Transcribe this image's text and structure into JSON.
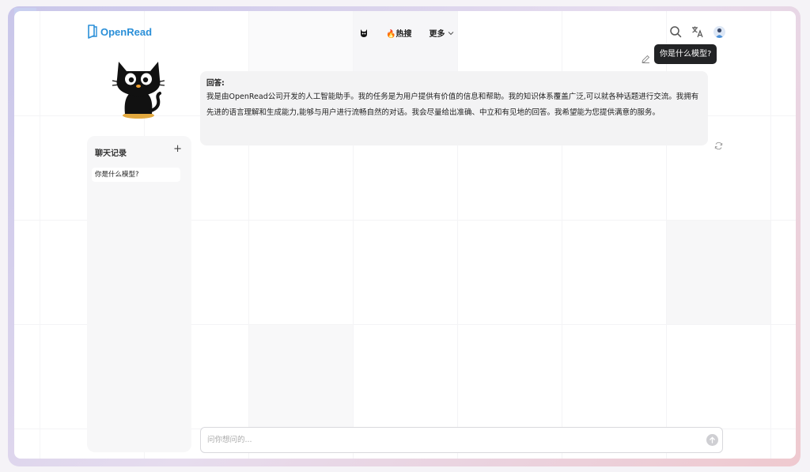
{
  "header": {
    "logo_text": "OpenRead",
    "nav": {
      "hot_label": "🔥热搜",
      "more_label": "更多"
    },
    "tools": [
      "search-icon",
      "translate-icon",
      "user-avatar"
    ]
  },
  "sidebar": {
    "title": "聊天记录",
    "add_label": "+",
    "items": [
      {
        "label": "你是什么模型?"
      }
    ]
  },
  "conversation": {
    "question": "你是什么模型?",
    "answer_label": "回答:",
    "answer_body": "我是由OpenRead公司开发的人工智能助手。我的任务是为用户提供有价值的信息和帮助。我的知识体系覆盖广泛,可以就各种话题进行交流。我拥有先进的语言理解和生成能力,能够与用户进行流畅自然的对话。我会尽量给出准确、中立和有见地的回答。我希望能为您提供满意的服务。"
  },
  "input": {
    "placeholder": "问你想问的...",
    "value": ""
  },
  "colors": {
    "brand": "#2a8fd8",
    "tooltip_bg": "#222325",
    "answer_bg": "#f3f3f4",
    "sidebar_bg": "#f7f7f8"
  }
}
